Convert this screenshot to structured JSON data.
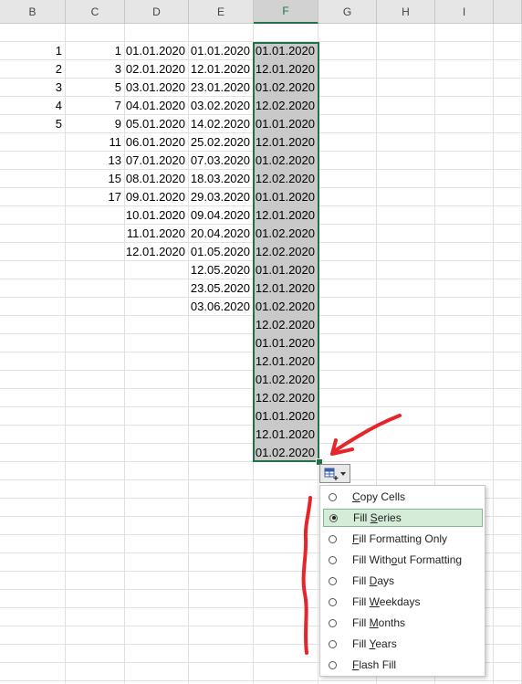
{
  "columns": [
    {
      "label": "B"
    },
    {
      "label": "C"
    },
    {
      "label": "D"
    },
    {
      "label": "E"
    },
    {
      "label": "F"
    },
    {
      "label": "G"
    },
    {
      "label": "H"
    },
    {
      "label": "I"
    }
  ],
  "cells": {
    "B": [
      "1",
      "2",
      "3",
      "4",
      "5"
    ],
    "C": [
      "1",
      "3",
      "5",
      "7",
      "9",
      "11",
      "13",
      "15",
      "17"
    ],
    "D": [
      "01.01.2020",
      "02.01.2020",
      "03.01.2020",
      "04.01.2020",
      "05.01.2020",
      "06.01.2020",
      "07.01.2020",
      "08.01.2020",
      "09.01.2020",
      "10.01.2020",
      "11.01.2020",
      "12.01.2020"
    ],
    "E": [
      "01.01.2020",
      "12.01.2020",
      "23.01.2020",
      "03.02.2020",
      "14.02.2020",
      "25.02.2020",
      "07.03.2020",
      "18.03.2020",
      "29.03.2020",
      "09.04.2020",
      "20.04.2020",
      "01.05.2020",
      "12.05.2020",
      "23.05.2020",
      "03.06.2020"
    ],
    "F": [
      "01.01.2020",
      "12.01.2020",
      "01.02.2020",
      "12.02.2020",
      "01.01.2020",
      "12.01.2020",
      "01.02.2020",
      "12.02.2020",
      "01.01.2020",
      "12.01.2020",
      "01.02.2020",
      "12.02.2020",
      "01.01.2020",
      "12.01.2020",
      "01.02.2020",
      "12.02.2020",
      "01.01.2020",
      "12.01.2020",
      "01.02.2020",
      "12.02.2020",
      "01.01.2020",
      "12.01.2020",
      "01.02.2020"
    ]
  },
  "autofill_menu": {
    "items": [
      {
        "label": "Copy Cells",
        "accel": "C",
        "selected": false
      },
      {
        "label": "Fill Series",
        "accel": "S",
        "selected": true
      },
      {
        "label": "Fill Formatting Only",
        "accel": "F",
        "selected": false
      },
      {
        "label": "Fill Without Formatting",
        "accel": "o",
        "selected": false
      },
      {
        "label": "Fill Days",
        "accel": "D",
        "selected": false
      },
      {
        "label": "Fill Weekdays",
        "accel": "W",
        "selected": false
      },
      {
        "label": "Fill Months",
        "accel": "M",
        "selected": false
      },
      {
        "label": "Fill Years",
        "accel": "Y",
        "selected": false
      },
      {
        "label": "Flash Fill",
        "accel": "F",
        "selected": false
      }
    ]
  },
  "colors": {
    "accent": "#217346",
    "selection_fill": "#c9c9c9",
    "annotation": "#e8242b"
  }
}
